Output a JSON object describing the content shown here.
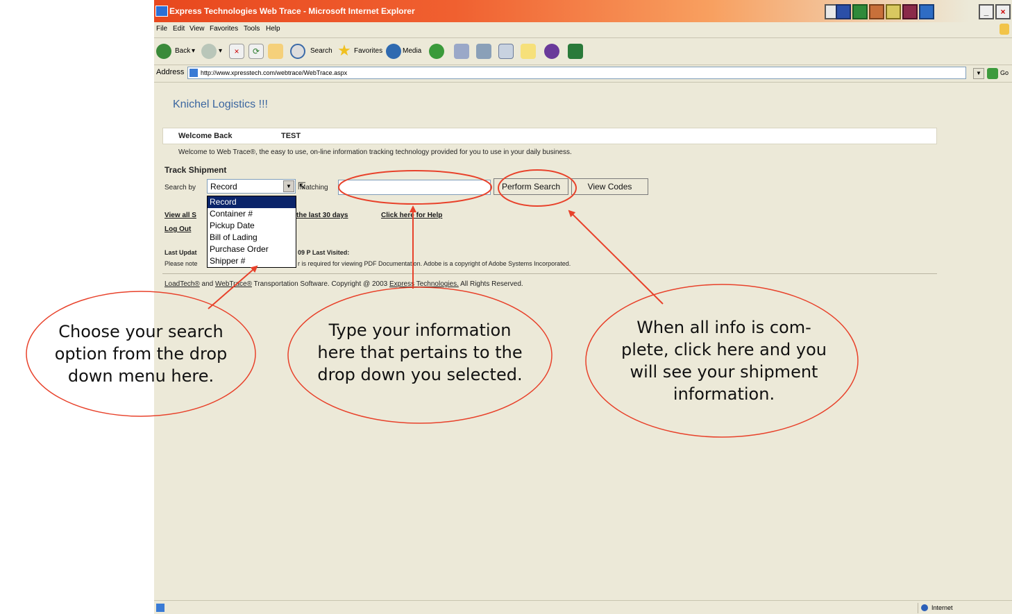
{
  "window": {
    "title": "Express Technologies Web Trace - Microsoft Internet Explorer",
    "controls": [
      "_",
      "×"
    ]
  },
  "menubar": {
    "items": [
      "File",
      "Edit",
      "View",
      "Favorites",
      "Tools",
      "Help"
    ]
  },
  "toolbar": {
    "back_label": "Back",
    "search_label": "Search",
    "favorites_label": "Favorites",
    "media_label": "Media"
  },
  "address": {
    "label": "Address",
    "url": "http://www.xpresstech.com/webtrace/WebTrace.aspx",
    "go_label": "Go"
  },
  "page": {
    "brand": "Knichel Logistics !!!",
    "welcome_back": "Welcome Back",
    "welcome_user": "TEST",
    "intro": "Welcome to Web Trace®, the easy to use, on-line information tracking technology provided for you to use in your daily business.",
    "track_heading": "Track Shipment",
    "search_by_label": "Search by",
    "search_by_value": "Record",
    "matching_label": "Matching",
    "perform_search": "Perform Search",
    "view_codes": "View Codes",
    "dropdown_options": [
      "Record",
      "Container #",
      "Pickup Date",
      "Bill of Lading",
      "Purchase Order",
      "Shipper #"
    ],
    "link_view_all": "View all S",
    "link_last30": "the last 30 days",
    "link_help": "Click here for Help",
    "link_logout": "Log Out",
    "last_update_label": "Last Updat",
    "last_update_suffix": "09 P Last Visited:",
    "note_prefix": "Please note",
    "note_suffix": "r is required for viewing PDF Documentation. Adobe is a copyright of Adobe Systems Incorporated.",
    "footer_loadtech": "LoadTech®",
    "footer_and": " and ",
    "footer_webtrace": "WebTrace®",
    "footer_middle": " Transportation Software. Copyright @ 2003 ",
    "footer_company": "Express Technologies.",
    "footer_end": " All Rights Reserved."
  },
  "status": {
    "zone": "Internet"
  },
  "annotations": {
    "left": "Choose your search option from the drop down menu here.",
    "middle": "Type your information here that pertains to the drop down you selected.",
    "right": "When all info is com-plete, click here and you will see your shipment information."
  },
  "colors": {
    "annotation": "#E8412A",
    "title_bar": "#E8481E",
    "page_bg": "#ECE9D8",
    "brand_text": "#3b66a0"
  }
}
